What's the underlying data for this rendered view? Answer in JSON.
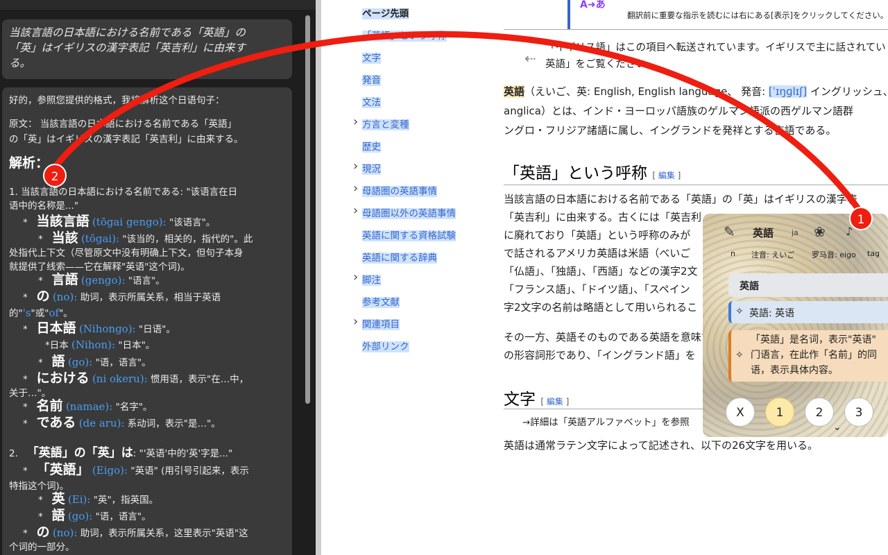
{
  "chat": {
    "user_message": "当該言語の日本語における名前である「英語」の「英」はイギリスの漢字表記「英吉利」に由来する。",
    "user_lines": [
      "当該言語の日本語における名前である「英語」の",
      "「英」はイギリスの漢字表記「英吉利」に由来す",
      "る。"
    ],
    "reply_intro": "好的，参照您提供的格式，我将解析这个日语句子：",
    "original_line1": "原文： 当該言語の日本語における名前である「英語」",
    "original_line2": "の「英」はイギリスの漢字表記「英吉利」に由来する。",
    "analysis_heading": "解析：",
    "p1_line1": "1. 当該言語の日本語における名前である: \"该语言在日",
    "p1_line2": "语中的名称是...\"",
    "tougai_gengo": {
      "jp": "当該言語",
      "rom": "(tōgai gengo):",
      "gloss": "\"该语言\"。"
    },
    "tougai": {
      "jp": "当該",
      "rom": "(tōgai):",
      "gloss": "\"该当的，相关的，指代的\"。此",
      "gloss2": "处指代上下文（尽管原文中没有明确上下文，但句子本身",
      "gloss3": "就提供了线索——它在解释\"英语\"这个词)。"
    },
    "gengo": {
      "jp": "言語",
      "rom": "(gengo):",
      "gloss": "\"语言\"。"
    },
    "no": {
      "jp": "の",
      "rom": "(no):",
      "gloss": "助词，表示所属关系，相当于英语",
      "gloss2_a": "的\"",
      "gloss2_s": "'s",
      "gloss2_b": "\"或\"",
      "gloss2_of": "of",
      "gloss2_c": "\"。"
    },
    "nihongo": {
      "jp": "日本語",
      "rom": "(Nihongo):",
      "gloss": "\"日语\"。"
    },
    "nihon": {
      "pre": "*日本",
      "rom": "(Nihon):",
      "gloss": "\"日本\"。"
    },
    "go": {
      "jp": "語",
      "rom": "(go):",
      "gloss": "\"语，语言\"。"
    },
    "niokeru": {
      "jp": "における",
      "rom": "(ni okeru):",
      "gloss": "惯用语，表示\"在…中，",
      "gloss2": "关于…\"。"
    },
    "namae": {
      "jp": "名前",
      "rom": "(namae):",
      "gloss": "\"名字\"。"
    },
    "dearu": {
      "jp": "である",
      "rom": "(de aru):",
      "gloss": "系动词，表示\"是…\"。"
    },
    "p2_num": "2.",
    "p2_jp": "「英語」の「英」は",
    "p2_gloss": ": \"'英语'中的'英'字是...\"",
    "eigo": {
      "jp": "「英語」",
      "rom": "(Eigo):",
      "gloss": "\"英语\" (用引号引起来，表示",
      "gloss2": "特指这个词)。"
    },
    "ei": {
      "jp": "英",
      "rom": "(Ei):",
      "gloss": "\"英\"，指英国。"
    },
    "go2": {
      "jp": "語",
      "rom": "(go):",
      "gloss": "\"语，语言\"。"
    },
    "no2": {
      "jp": "の",
      "rom": "(no):",
      "gloss": "助词，表示所属关系，这里表示\"英语\"这",
      "gloss2": "个词的一部分。"
    },
    "bullet": "*"
  },
  "toc": {
    "top": "ページ先頭",
    "items": [
      {
        "label": "「英語」という呼称",
        "expandable": false
      },
      {
        "label": "文字",
        "expandable": false
      },
      {
        "label": "発音",
        "expandable": false
      },
      {
        "label": "文法",
        "expandable": false
      },
      {
        "label": "方言と変種",
        "expandable": true
      },
      {
        "label": "歴史",
        "expandable": false
      },
      {
        "label": "現況",
        "expandable": true
      },
      {
        "label": "母語圏の英語事情",
        "expandable": true
      },
      {
        "label": "母語圏以外の英語事情",
        "expandable": true
      },
      {
        "label": "英語に関する資格試験",
        "expandable": false
      },
      {
        "label": "英語に関する辞典",
        "expandable": false
      },
      {
        "label": "脚注",
        "expandable": true
      },
      {
        "label": "参考文献",
        "expandable": false
      },
      {
        "label": "関連項目",
        "expandable": true
      },
      {
        "label": "外部リンク",
        "expandable": false
      }
    ]
  },
  "article": {
    "notice_text": "翻訳前に重要な指示を読むには右にある[表示]をクリックしてください。",
    "redirect_line1": "「イギリス語」はこの項目へ転送されています。イギリスで主に話されてい",
    "redirect_line2": "英語」をご覧ください。",
    "lead_line1_a": "英語",
    "lead_line1_b": "（えいご、英: English, English language、 発音:",
    "lead_ipa": "[ˈɪŋɡlɪʃ]",
    "lead_line1_c": "イングリッシュ、",
    "lead_line2": "anglica）とは、インド・ヨーロッパ語族のゲルマン語派の西ゲルマン語群",
    "lead_line3": "ングロ・フリジア諸語に属し、イングランドを発祥とする言語である。",
    "h2_name": "「英語」という呼称",
    "edit": "編集",
    "name_p1": "当該言語の日本語における名前である「英語」の「英」はイギリスの漢字表",
    "name_p2": "「英吉利」に由来する。古くには「英吉利",
    "name_p3": "に廃れており「英語」という呼称のみが",
    "name_p4": "で話されるアメリカ英語は米語（べいご",
    "name_p5": "「仏語」、「独語」、「西語」などの漢字2文",
    "name_p6": "「フランス語」、「ドイツ語」、「スペイン",
    "name_p7": "字2文字の名前は略語として用いられるこ",
    "name_p8": "その一方、英語そのものである英語を意味す",
    "name_p9": "の形容詞形であり、「イングランド語」を",
    "h2_letters": "文字",
    "detail": "→詳細は「英語アルファベット」を参照",
    "letters_p": "英語は通常ラテン文字によって記述され、以下の26文字を用いる。"
  },
  "popup": {
    "word": "英語",
    "lang": "ja",
    "pos": "n",
    "reading": "注音: えいご",
    "romaji": "罗马音: eigo",
    "tag": "tag",
    "header": "英語",
    "translation": "英語: 英语",
    "explanation_line1": "「英語」是名词，表示\"英语\"",
    "explanation_line2": "门语言，在此作「名前」的同",
    "explanation_line3": "语，表示具体内容。",
    "buttons": [
      "X",
      "1",
      "2",
      "3"
    ],
    "active_button": "1",
    "more": "⌄"
  },
  "markers": {
    "m1": "1",
    "m2": "2"
  },
  "colors": {
    "arrow": "#ee1e10",
    "link": "#3366cc",
    "highlight_blue": "#cfe2fb",
    "highlight_yellow": "#fde9b6"
  }
}
